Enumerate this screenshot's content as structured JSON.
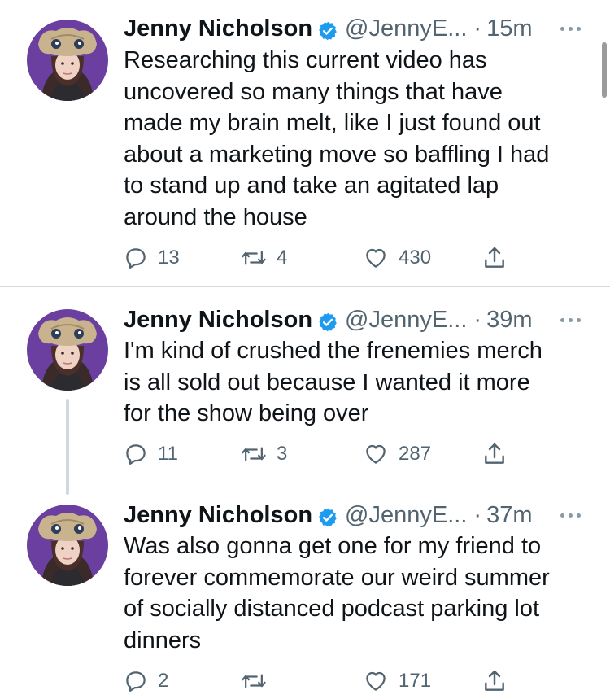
{
  "tweets": [
    {
      "display_name": "Jenny Nicholson",
      "handle": "@JennyE...",
      "separator": "·",
      "time": "15m",
      "text": "Researching this current video has\nuncovered so many things that have\nmade my brain melt, like I just found out\nabout a marketing move so baffling I had\nto stand up and take an agitated lap\naround the house",
      "replies": "13",
      "retweets": "4",
      "likes": "430"
    },
    {
      "display_name": "Jenny Nicholson",
      "handle": "@JennyE...",
      "separator": "·",
      "time": "39m",
      "text": "I'm kind of crushed the frenemies merch\nis all sold out because I wanted it more\nfor the show being over",
      "replies": "11",
      "retweets": "3",
      "likes": "287"
    },
    {
      "display_name": "Jenny Nicholson",
      "handle": "@JennyE...",
      "separator": "·",
      "time": "37m",
      "text": "Was also gonna get one for my friend to\nforever commemorate our weird summer\nof socially distanced podcast parking lot\ndinners",
      "replies": "2",
      "retweets": "",
      "likes": "171"
    }
  ],
  "icons": {
    "reply": "reply-icon",
    "retweet": "retweet-icon",
    "like": "heart-icon",
    "share": "share-icon",
    "verified": "verified-badge-icon",
    "more": "more-options-icon"
  },
  "colors": {
    "verified": "#1d9bf0",
    "muted": "#536471",
    "avatar_bg": "#6a3fa0"
  }
}
